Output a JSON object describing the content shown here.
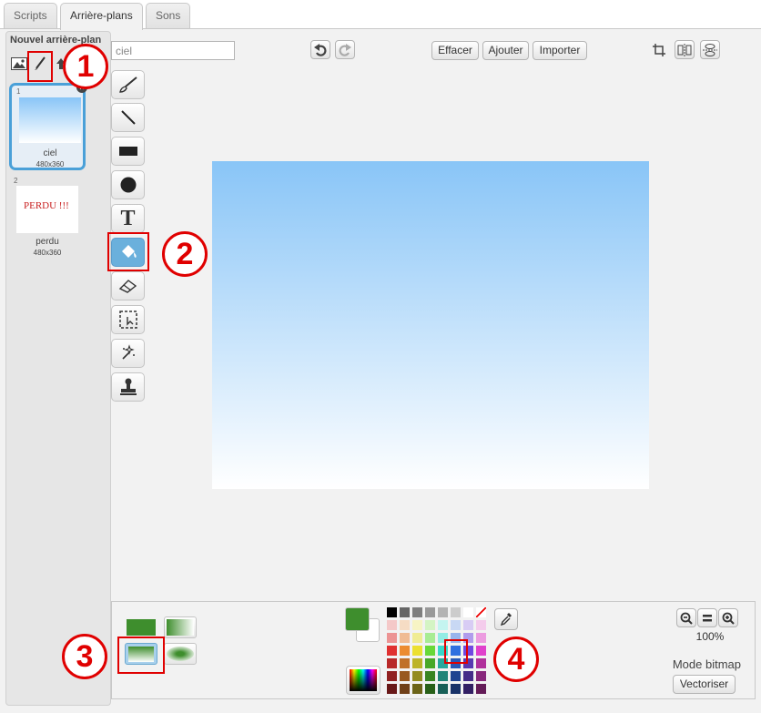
{
  "tabs": [
    {
      "label": "Scripts"
    },
    {
      "label": "Arrière-plans"
    },
    {
      "label": "Sons"
    }
  ],
  "sidebar": {
    "new_backdrop_label": "Nouvel arrière-plan",
    "backdrops": [
      {
        "number": "1",
        "name": "ciel",
        "size": "480x360",
        "selected": true
      },
      {
        "number": "2",
        "name": "perdu",
        "size": "480x360",
        "preview_text": "PERDU !!!"
      }
    ]
  },
  "editor": {
    "costume_name": "ciel",
    "clear_label": "Effacer",
    "add_label": "Ajouter",
    "import_label": "Importer",
    "selected_tool": "fill-tool",
    "tools": [
      "brush-tool",
      "line-tool",
      "rectangle-tool",
      "ellipse-tool",
      "text-tool",
      "fill-tool",
      "eraser-tool",
      "select-tool",
      "reshape-tool",
      "stamp-tool"
    ],
    "zoom_label": "100%",
    "mode_label": "Mode bitmap",
    "convert_label": "Vectoriser",
    "gradient": {
      "top": "#89c5f7",
      "bottom": "#ffffff"
    },
    "primary_color": "#3e8e2d",
    "secondary_color": "#ffffff"
  },
  "annotations": [
    {
      "label": "1"
    },
    {
      "label": "2"
    },
    {
      "label": "3"
    },
    {
      "label": "4"
    }
  ]
}
